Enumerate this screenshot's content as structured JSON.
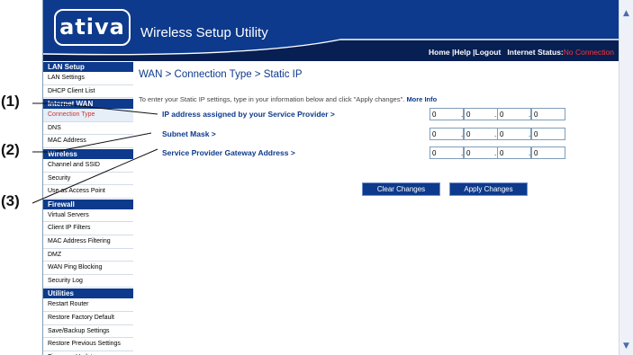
{
  "header": {
    "logo": "ativa",
    "app_title": "Wireless Setup Utility",
    "nav": {
      "home": "Home",
      "help": "Help",
      "logout": "Logout",
      "internet_status_label": "Internet Status:",
      "internet_status_value": "No Connection"
    }
  },
  "sidebar": {
    "sections": [
      {
        "title": "LAN Setup",
        "items": [
          "LAN Settings",
          "DHCP Client List"
        ]
      },
      {
        "title": "Internet WAN",
        "items": [
          "Connection Type",
          "DNS",
          "MAC Address"
        ]
      },
      {
        "title": "Wireless",
        "items": [
          "Channel and SSID",
          "Security",
          "Use as Access Point"
        ]
      },
      {
        "title": "Firewall",
        "items": [
          "Virtual Servers",
          "Client IP Filters",
          "MAC Address Filtering",
          "DMZ",
          "WAN Ping Blocking",
          "Security Log"
        ]
      },
      {
        "title": "Utilities",
        "items": [
          "Restart Router",
          "Restore Factory Default",
          "Save/Backup Settings",
          "Restore Previous Settings",
          "Firmware Update"
        ]
      }
    ],
    "active_item": "Connection Type"
  },
  "main": {
    "title": "WAN > Connection Type > Static IP",
    "instructions": "To enter your Static IP settings, type in your information below and click \"Apply changes\".",
    "more_info": "More Info",
    "fields": [
      {
        "label": "IP address assigned by your Service Provider >",
        "octets": [
          "0",
          "0",
          "0",
          "0"
        ]
      },
      {
        "label": "Subnet Mask >",
        "octets": [
          "0",
          "0",
          "0",
          "0"
        ]
      },
      {
        "label": "Service Provider Gateway Address >",
        "octets": [
          "0",
          "0",
          "0",
          "0"
        ]
      }
    ],
    "buttons": {
      "clear": "Clear Changes",
      "apply": "Apply Changes"
    }
  },
  "callouts": [
    "(1)",
    "(2)",
    "(3)"
  ],
  "colors": {
    "brand_blue": "#0d3a8c",
    "status_red": "#ff3333",
    "active_red": "#cc3333"
  }
}
